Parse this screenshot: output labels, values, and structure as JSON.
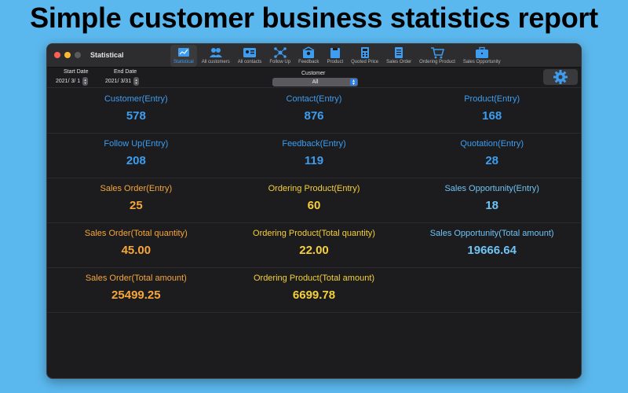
{
  "headline": "Simple customer business statistics report",
  "window": {
    "title": "Statistical"
  },
  "toolbar": [
    {
      "label": "Statistical",
      "icon": "chart-icon",
      "active": true
    },
    {
      "label": "All customers",
      "icon": "customers-icon"
    },
    {
      "label": "All contacts",
      "icon": "contacts-icon"
    },
    {
      "label": "Follow Up",
      "icon": "follow-up-icon"
    },
    {
      "label": "Feedback",
      "icon": "feedback-icon"
    },
    {
      "label": "Product",
      "icon": "product-icon"
    },
    {
      "label": "Quoted Price",
      "icon": "calculator-icon"
    },
    {
      "label": "Sales Order",
      "icon": "document-icon"
    },
    {
      "label": "Ordering Product",
      "icon": "cart-icon"
    },
    {
      "label": "Sales Opportunity",
      "icon": "briefcase-icon"
    }
  ],
  "filters": {
    "start_label": "Start Date",
    "start_value": "2021/  3/  1",
    "end_label": "End Date",
    "end_value": "2021/  3/31",
    "customer_label": "Customer",
    "customer_value": "All"
  },
  "colors": {
    "blue": "#3d9df0",
    "orange": "#f7a63a",
    "yellow": "#f5d03c",
    "cyan": "#6fc3f5"
  },
  "stats": [
    [
      {
        "label": "Customer(Entry)",
        "value": "578",
        "color": "blue"
      },
      {
        "label": "Contact(Entry)",
        "value": "876",
        "color": "blue"
      },
      {
        "label": "Product(Entry)",
        "value": "168",
        "color": "blue"
      }
    ],
    [
      {
        "label": "Follow Up(Entry)",
        "value": "208",
        "color": "blue"
      },
      {
        "label": "Feedback(Entry)",
        "value": "119",
        "color": "blue"
      },
      {
        "label": "Quotation(Entry)",
        "value": "28",
        "color": "blue"
      }
    ],
    [
      {
        "label": "Sales Order(Entry)",
        "value": "25",
        "color": "orange"
      },
      {
        "label": "Ordering Product(Entry)",
        "value": "60",
        "color": "yellow"
      },
      {
        "label": "Sales Opportunity(Entry)",
        "value": "18",
        "color": "cyan"
      }
    ],
    [
      {
        "label": "Sales Order(Total quantity)",
        "value": "45.00",
        "color": "orange"
      },
      {
        "label": "Ordering Product(Total quantity)",
        "value": "22.00",
        "color": "yellow"
      },
      {
        "label": "Sales Opportunity(Total amount)",
        "value": "19666.64",
        "color": "cyan"
      }
    ],
    [
      {
        "label": "Sales Order(Total amount)",
        "value": "25499.25",
        "color": "orange"
      },
      {
        "label": "Ordering Product(Total amount)",
        "value": "6699.78",
        "color": "yellow"
      }
    ]
  ]
}
